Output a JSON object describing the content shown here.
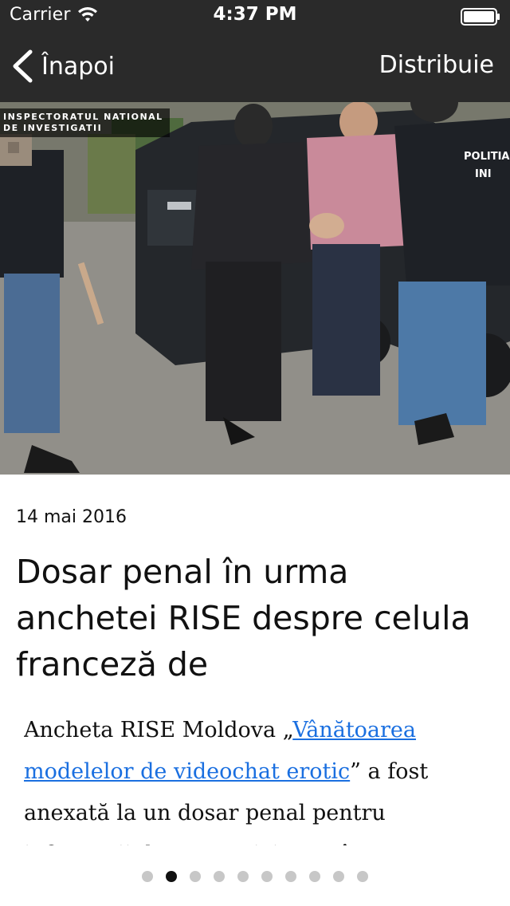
{
  "status_bar": {
    "carrier": "Carrier",
    "time": "4:37 PM",
    "wifi_icon": "wifi-icon",
    "battery_icon": "battery-icon"
  },
  "nav": {
    "back_label": "Înapoi",
    "back_icon": "chevron-left-icon",
    "share_label": "Distribuie"
  },
  "hero": {
    "watermark_line1": "INSPECTORATUL NATIONAL",
    "watermark_line2": "DE INVESTIGATII",
    "vest_text_line1": "POLITIA",
    "vest_text_line2": "INI"
  },
  "article": {
    "date": "14 mai 2016",
    "title": "Dosar penal în urma anchetei RISE despre celula franceză de",
    "body_prefix": "Ancheta RISE Moldova „",
    "body_link": "Vânătoarea modelelor de videochat erotic",
    "body_suffix": "” a fost anexată la un dosar penal pentru informatii despre activitatea în"
  },
  "pager": {
    "count": 10,
    "active_index": 1
  },
  "colors": {
    "bar_background": "#2a2a2a",
    "link": "#1a6fe0",
    "dot_inactive": "#c7c7c7",
    "dot_active": "#111111"
  }
}
